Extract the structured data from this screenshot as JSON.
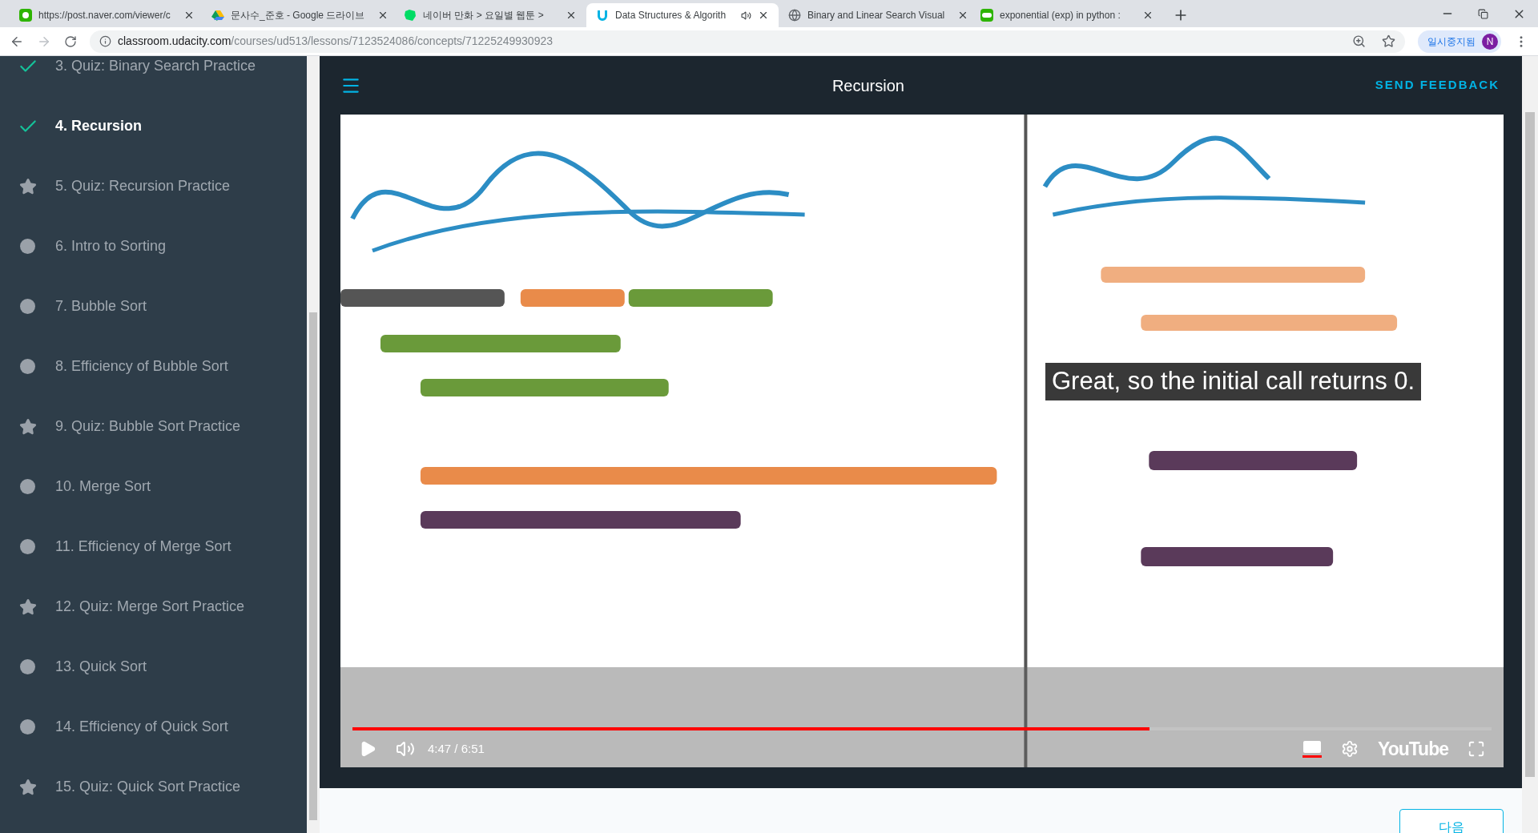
{
  "browser": {
    "tabs": [
      {
        "title": "https://post.naver.com/viewer/c",
        "kind": "naver-post",
        "selected": false,
        "audio": false
      },
      {
        "title": "문사수_준호 - Google 드라이브",
        "kind": "drive",
        "selected": false,
        "audio": false
      },
      {
        "title": "네이버 만화 > 요일별 웹툰 >",
        "kind": "webtoon",
        "selected": false,
        "audio": false
      },
      {
        "title": "Data Structures & Algorith",
        "kind": "udacity",
        "selected": true,
        "audio": true
      },
      {
        "title": "Binary and Linear Search Visual",
        "kind": "globe",
        "selected": false,
        "audio": false
      },
      {
        "title": "exponential (exp) in python :",
        "kind": "blog",
        "selected": false,
        "audio": false
      }
    ],
    "address": {
      "host": "classroom.udacity.com",
      "path": "/courses/ud513/lessons/7123524086/concepts/71225249930923"
    },
    "profile": {
      "status": "일시중지됨",
      "initial": "N"
    }
  },
  "sidebar": {
    "items": [
      {
        "label": "3. Quiz: Binary Search Practice",
        "kind": "done",
        "selected": false
      },
      {
        "label": "4. Recursion",
        "kind": "done",
        "selected": true
      },
      {
        "label": "5. Quiz: Recursion Practice",
        "kind": "quiz",
        "selected": false
      },
      {
        "label": "6. Intro to Sorting",
        "kind": "lesson",
        "selected": false
      },
      {
        "label": "7. Bubble Sort",
        "kind": "lesson",
        "selected": false
      },
      {
        "label": "8. Efficiency of Bubble Sort",
        "kind": "lesson",
        "selected": false
      },
      {
        "label": "9. Quiz: Bubble Sort Practice",
        "kind": "quiz",
        "selected": false
      },
      {
        "label": "10. Merge Sort",
        "kind": "lesson",
        "selected": false
      },
      {
        "label": "11. Efficiency of Merge Sort",
        "kind": "lesson",
        "selected": false
      },
      {
        "label": "12. Quiz: Merge Sort Practice",
        "kind": "quiz",
        "selected": false
      },
      {
        "label": "13. Quick Sort",
        "kind": "lesson",
        "selected": false
      },
      {
        "label": "14. Efficiency of Quick Sort",
        "kind": "lesson",
        "selected": false
      },
      {
        "label": "15. Quiz: Quick Sort Practice",
        "kind": "quiz",
        "selected": false
      }
    ]
  },
  "header": {
    "title": "Recursion",
    "feedback": "SEND FEEDBACK"
  },
  "video": {
    "kind": "picture",
    "caption": "Great, so the initial call returns 0.",
    "progress": {
      "level": 0.7
    },
    "time": "4:47 / 6:51",
    "logo": "YouTube",
    "captions_on": true
  },
  "next_button": "다음"
}
